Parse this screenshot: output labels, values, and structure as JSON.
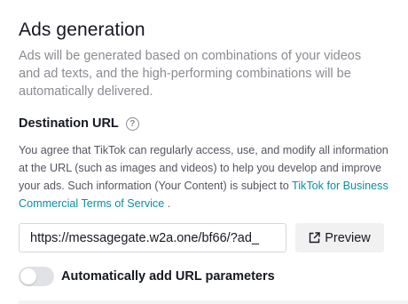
{
  "section": {
    "title": "Ads generation",
    "description": "Ads will be generated based on combinations of your videos and ad texts, and the high-performing combinations will be automatically delivered."
  },
  "destination_url": {
    "label": "Destination URL",
    "help_icon": "question-circle-icon",
    "consent_text": "You agree that TikTok can regularly access, use, and modify all information at the URL (such as images and videos) to help you develop and improve your ads. Such information (Your Content) is subject to",
    "consent_link": "TikTok for Business Commercial Terms of Service",
    "consent_end": ".",
    "input_value": "https://messagegate.w2a.one/bf66/?ad_",
    "preview_label": "Preview",
    "preview_icon": "external-link-icon"
  },
  "url_parameters": {
    "toggle_label": "Automatically add URL parameters",
    "toggle_on": false
  },
  "colors": {
    "link": "#0b8ea0",
    "text": "#161823",
    "muted": "#8a8b91"
  }
}
